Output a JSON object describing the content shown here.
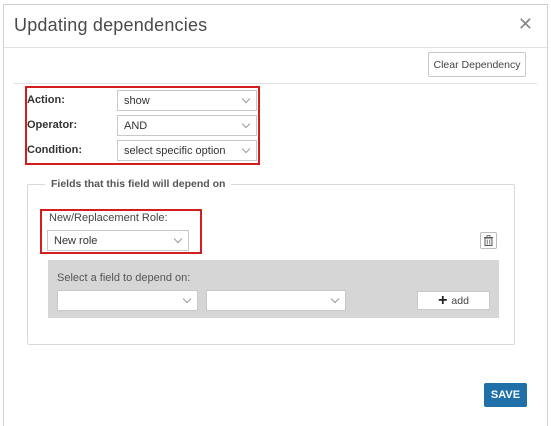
{
  "dialog": {
    "title": "Updating dependencies",
    "close_icon": "close-icon",
    "clear_button": "Clear Dependency",
    "save_button": "SAVE"
  },
  "form": {
    "action": {
      "label": "Action:",
      "value": "show"
    },
    "operator": {
      "label": "Operator:",
      "value": "AND"
    },
    "condition": {
      "label": "Condition:",
      "value": "select specific option"
    }
  },
  "fields_section": {
    "legend": "Fields that this field will depend on",
    "role_label": "New/Replacement Role:",
    "role_value": "New role",
    "depend_label": "Select a field to depend on:",
    "field_select_1": "",
    "field_select_2": "",
    "add_button": "add",
    "icons": [
      "trash-icon",
      "plus-icon",
      "chevron-down-icon"
    ]
  },
  "colors": {
    "highlight": "#d41d1d",
    "save_button_bg": "#1f6fa8",
    "panel_gray": "#d6d6d6"
  }
}
